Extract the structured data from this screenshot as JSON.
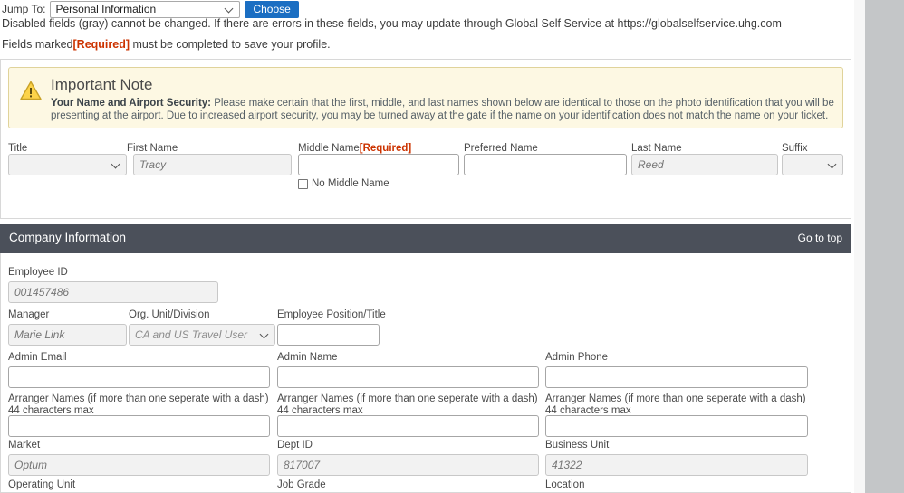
{
  "jump": {
    "label": "Jump To:",
    "selected": "Personal Information",
    "button": "Choose"
  },
  "notices": {
    "disabled_fields": "Disabled fields (gray) cannot be changed. If there are errors in these fields, you may update through Global Self Service at https://globalselfservice.uhg.com",
    "required_prefix": "Fields marked",
    "required_tag": "[Required]",
    "required_suffix": " must be completed to save your profile."
  },
  "important_note": {
    "icon": "warning-triangle-icon",
    "title": "Important Note",
    "body_bold": "Your Name and Airport Security:",
    "body_text": " Please make certain that the first, middle, and last names shown below are identical to those on the photo identification that you will be presenting at the airport. Due to increased airport security, you may be turned away at the gate if the name on your identification does not match the name on your ticket."
  },
  "personal": {
    "title": {
      "label": "Title",
      "value": ""
    },
    "first_name": {
      "label": "First Name",
      "value": "Tracy"
    },
    "middle_name": {
      "label": "Middle Name",
      "required_tag": "[Required]",
      "value": ""
    },
    "no_middle_name": {
      "label": "No Middle Name",
      "checked": false
    },
    "preferred_name": {
      "label": "Preferred Name",
      "value": ""
    },
    "last_name": {
      "label": "Last Name",
      "value": "Reed"
    },
    "suffix": {
      "label": "Suffix",
      "value": ""
    }
  },
  "company": {
    "section_title": "Company Information",
    "go_to_top": "Go to top",
    "employee_id": {
      "label": "Employee ID",
      "value": "001457486"
    },
    "manager": {
      "label": "Manager",
      "value": "Marie Link"
    },
    "org_unit": {
      "label": "Org. Unit/Division",
      "value": "CA and US Travel User"
    },
    "employee_position": {
      "label": "Employee Position/Title",
      "value": ""
    },
    "admin_email": {
      "label": "Admin Email",
      "value": ""
    },
    "admin_name": {
      "label": "Admin Name",
      "value": ""
    },
    "admin_phone": {
      "label": "Admin Phone",
      "value": ""
    },
    "arranger_1": {
      "label": "Arranger Names (if more than one seperate with a dash) 44 characters max",
      "value": ""
    },
    "arranger_2": {
      "label": "Arranger Names (if more than one seperate with a dash) 44 characters max",
      "value": ""
    },
    "arranger_3": {
      "label": "Arranger Names (if more than one seperate with a dash) 44 characters max",
      "value": ""
    },
    "market": {
      "label": "Market",
      "value": "Optum"
    },
    "dept_id": {
      "label": "Dept ID",
      "value": "817007"
    },
    "business_unit": {
      "label": "Business Unit",
      "value": "41322"
    },
    "operating_unit": {
      "label": "Operating Unit",
      "value": ""
    },
    "job_grade": {
      "label": "Job Grade",
      "value": ""
    },
    "location": {
      "label": "Location",
      "value": ""
    }
  },
  "colors": {
    "accent_blue": "#1b6ec2",
    "required_red": "#cc3300",
    "section_header": "#4b505a",
    "note_bg": "#fdf8e3",
    "note_border": "#e0d39a"
  }
}
